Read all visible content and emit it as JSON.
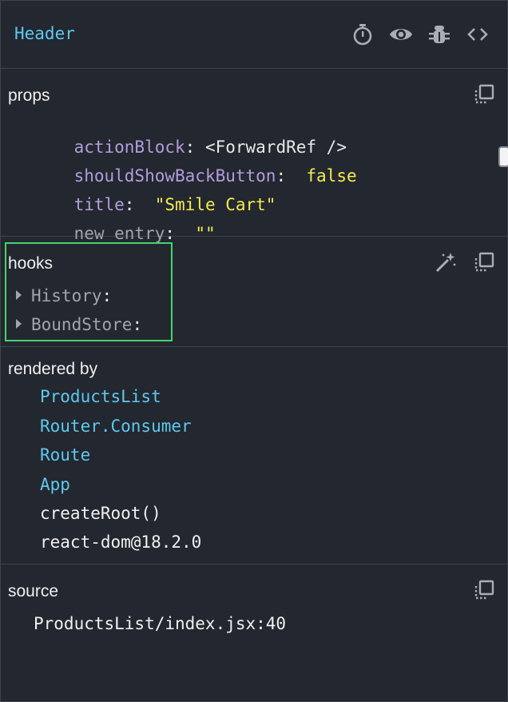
{
  "header": {
    "title": "Header",
    "icons": [
      "stopwatch-icon",
      "eye-icon",
      "bug-icon",
      "code-icon"
    ]
  },
  "props": {
    "title": "props",
    "items": [
      {
        "key": "actionBlock",
        "value": "<ForwardRef />",
        "type": "component"
      },
      {
        "key": "shouldShowBackButton",
        "value": "false",
        "type": "boolean"
      },
      {
        "key": "title",
        "value": "\"Smile Cart\"",
        "type": "string"
      },
      {
        "key": "new entry",
        "value": "\"\"",
        "type": "string"
      }
    ]
  },
  "hooks": {
    "title": "hooks",
    "items": [
      {
        "key": "History"
      },
      {
        "key": "BoundStore"
      }
    ]
  },
  "rendered_by": {
    "title": "rendered by",
    "items": [
      {
        "label": "ProductsList",
        "link": true
      },
      {
        "label": "Router.Consumer",
        "link": true
      },
      {
        "label": "Route",
        "link": true
      },
      {
        "label": "App",
        "link": true
      },
      {
        "label": "createRoot()",
        "link": false
      },
      {
        "label": "react-dom@18.2.0",
        "link": false
      }
    ]
  },
  "source": {
    "title": "source",
    "location": "ProductsList/index.jsx:40"
  },
  "colors": {
    "background": "#23272f",
    "accent_blue": "#5ec8ef",
    "prop_key": "#b39ddb",
    "value_yellow": "#f3ec4f",
    "highlight_green": "#46d36b"
  }
}
